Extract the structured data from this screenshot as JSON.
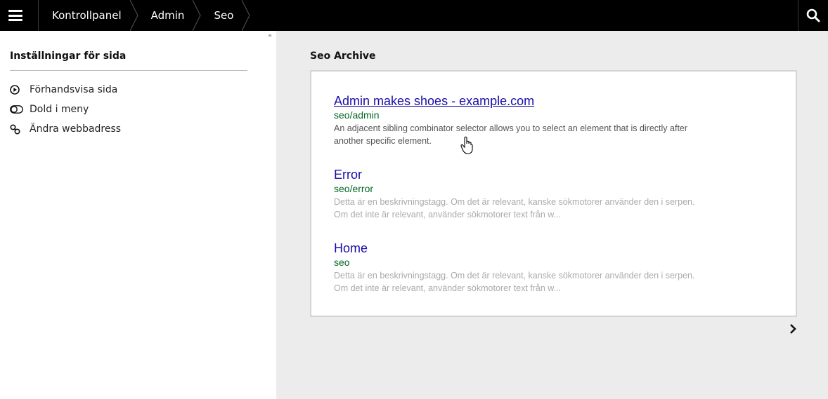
{
  "topbar": {
    "breadcrumbs": [
      {
        "label": "Kontrollpanel"
      },
      {
        "label": "Admin"
      },
      {
        "label": "Seo"
      }
    ],
    "menu_icon": "hamburger-icon",
    "search_icon": "search-icon"
  },
  "sidebar": {
    "title": "Inställningar för sida",
    "items": [
      {
        "label": "Förhandsvisa sida",
        "icon": "play-circle-icon"
      },
      {
        "label": "Dold i meny",
        "icon": "toggle-icon"
      },
      {
        "label": "Ändra webbadress",
        "icon": "link-icon"
      }
    ]
  },
  "main": {
    "title": "Seo Archive",
    "entries": [
      {
        "title": "Admin makes shoes - example.com",
        "url": "seo/admin",
        "description": "An adjacent sibling combinator selector allows you to select an element that is directly after another specific element."
      },
      {
        "title": "Error",
        "url": "seo/error",
        "description": "Detta är en beskrivningstagg. Om det är relevant, kanske sökmotorer använder den i serpen. Om det inte är relevant, använder sökmotorer text från w..."
      },
      {
        "title": "Home",
        "url": "seo",
        "description": "Detta är en beskrivningstagg. Om det är relevant, kanske sökmotorer använder den i serpen. Om det inte är relevant, använder sökmotorer text från w..."
      }
    ],
    "next_icon": "chevron-right-icon"
  },
  "colors": {
    "topbar": "#000000",
    "link_title": "#1a0dab",
    "url_green": "#006621",
    "background": "#ececec"
  }
}
